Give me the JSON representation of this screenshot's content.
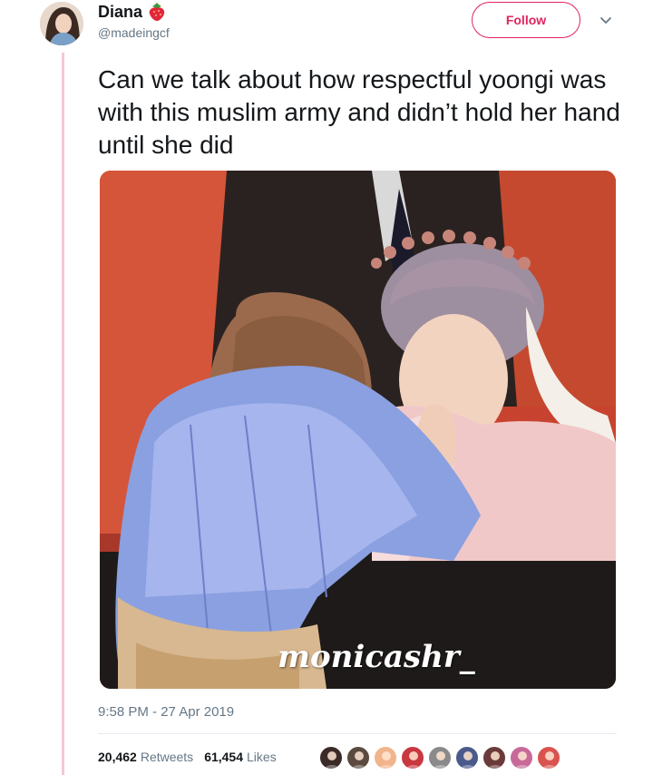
{
  "tweet": {
    "display_name": "Diana",
    "handle": "@madeingcf",
    "follow_label": "Follow",
    "text": "Can we talk about how respectful yoongi was with this muslim army and didn’t hold her hand until she did",
    "media_watermark": "monicashr_",
    "timestamp": "9:58 PM - 27 Apr 2019",
    "retweets_count": "20,462",
    "retweets_label": "Retweets",
    "likes_count": "61,454",
    "likes_label": "Likes"
  },
  "icons": {
    "name_emoji": "strawberry-icon",
    "menu": "chevron-down-icon"
  },
  "colors": {
    "accent": "#e0245e",
    "thread_line": "#f7c8d2",
    "secondary_text": "#657786",
    "primary_text": "#14171a"
  },
  "liker_avatars": [
    "#3a2a28",
    "#5a4a3f",
    "#f2b48c",
    "#c9373f",
    "#8a8a8a",
    "#4a5a8a",
    "#6b3a3a",
    "#c76a9a",
    "#d9534f"
  ]
}
